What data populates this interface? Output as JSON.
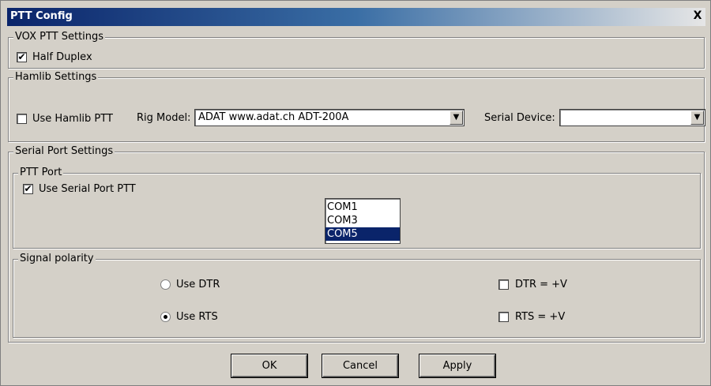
{
  "window": {
    "title": "PTT Config",
    "close_label": "X"
  },
  "vox": {
    "group_label": "VOX PTT Settings",
    "half_duplex": {
      "label": "Half Duplex",
      "checked": true
    }
  },
  "hamlib": {
    "group_label": "Hamlib Settings",
    "use_hamlib_ptt": {
      "label": "Use Hamlib PTT",
      "checked": false
    },
    "rig_model_label": "Rig Model:",
    "rig_model_value": "ADAT www.adat.ch ADT-200A",
    "serial_device_label": "Serial Device:",
    "serial_device_value": ""
  },
  "serial_port": {
    "group_label": "Serial Port Settings",
    "ptt_port": {
      "group_label": "PTT Port",
      "use_serial_ptt": {
        "label": "Use Serial Port PTT",
        "checked": true
      },
      "ports": [
        "COM1",
        "COM3",
        "COM5"
      ],
      "selected_port": "COM5"
    },
    "polarity": {
      "group_label": "Signal polarity",
      "use_dtr": {
        "label": "Use DTR",
        "selected": false
      },
      "use_rts": {
        "label": "Use RTS",
        "selected": true
      },
      "dtr_pos": {
        "label": "DTR = +V",
        "checked": false
      },
      "rts_pos": {
        "label": "RTS = +V",
        "checked": false
      }
    }
  },
  "buttons": {
    "ok": "OK",
    "cancel": "Cancel",
    "apply": "Apply"
  },
  "colors": {
    "title_start": "#0a246a",
    "selection": "#0a246a",
    "face": "#d4d0c8"
  },
  "icons": {
    "check": "check-mark",
    "close": "close-icon",
    "dropdown": "chevron-down-icon"
  }
}
